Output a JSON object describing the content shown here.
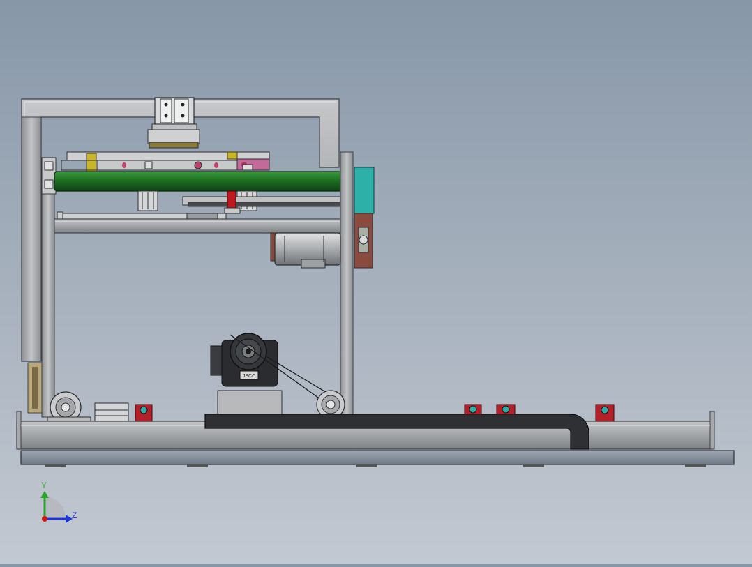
{
  "viewport": {
    "background_top": "#8797a8",
    "background_bottom": "#c3c9d2"
  },
  "triad": {
    "y_label": "Y",
    "z_label": "Z",
    "y_color": "#2aa52a",
    "z_color": "#1f35d8",
    "x_color": "#d01818"
  },
  "model": {
    "frame_color": "#a6a8ab",
    "roller_color": "#1f7a24",
    "motor_color": "#2a2c30",
    "pillow_block_color": "#b3202a",
    "teal_block_color": "#2db0a8",
    "drag_chain_color": "#2e3033",
    "gearbox_label": "JSCC"
  }
}
